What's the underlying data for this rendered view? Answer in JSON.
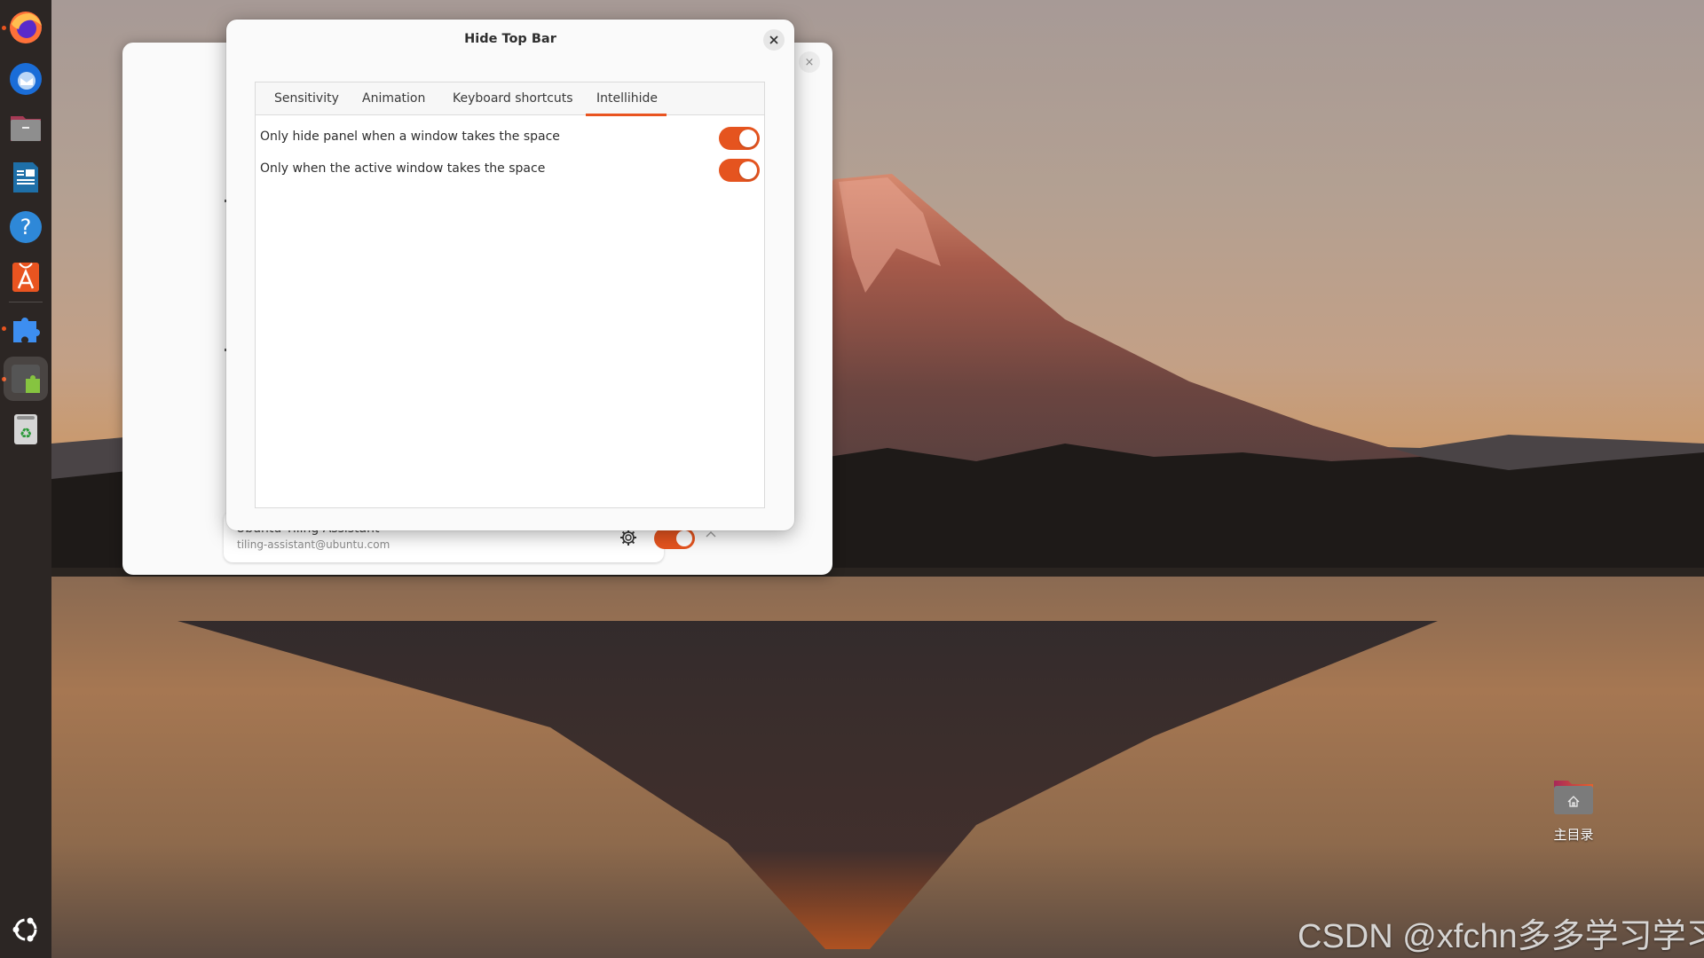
{
  "dock": {
    "items": [
      {
        "name": "firefox",
        "running": true
      },
      {
        "name": "thunderbird",
        "running": false
      },
      {
        "name": "files",
        "running": false
      },
      {
        "name": "libreoffice-writer",
        "running": false
      },
      {
        "name": "help",
        "running": false
      },
      {
        "name": "app-center",
        "running": false
      },
      {
        "name": "extensions",
        "running": true
      },
      {
        "name": "extension-manager",
        "running": true,
        "active": true
      },
      {
        "name": "trash",
        "running": false
      }
    ],
    "show_apps": "ubuntu-logo"
  },
  "background_window": {
    "close_glyph": "×",
    "extension": {
      "title": "Ubuntu Tiling Assistant",
      "uuid": "tiling-assistant@ubuntu.com",
      "enabled": true,
      "settings_icon": "gear-icon",
      "expand_icon": "chevron-up-icon"
    }
  },
  "dialog": {
    "title": "Hide Top Bar",
    "close_glyph": "×",
    "tabs": [
      {
        "label": "Sensitivity",
        "active": false
      },
      {
        "label": "Animation",
        "active": false
      },
      {
        "label": "Keyboard shortcuts",
        "active": false
      },
      {
        "label": "Intellihide",
        "active": true
      }
    ],
    "settings": [
      {
        "label": "Only hide panel when a window takes the space",
        "enabled": true
      },
      {
        "label": "Only when the active window takes the space",
        "enabled": true
      }
    ]
  },
  "desktop": {
    "icons": [
      {
        "label": "主目录",
        "icon": "home-folder-icon"
      }
    ]
  },
  "watermark": "CSDN @xfchn多多学习学习",
  "colors": {
    "accent": "#e95420",
    "dock_bg": "#2c2624",
    "dialog_bg": "#fafafa"
  }
}
